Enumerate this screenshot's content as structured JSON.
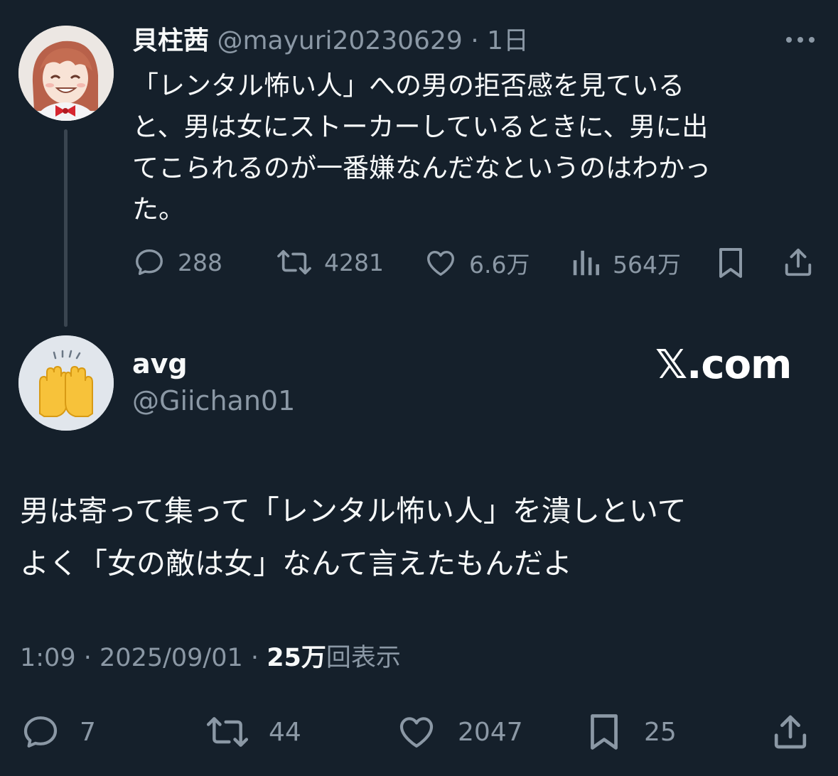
{
  "parent_tweet": {
    "display_name": "貝柱茜",
    "handle": "@mayuri20230629",
    "separator": "·",
    "time": "1日",
    "more_icon": "more-dots-icon",
    "text_lines": [
      "「レンタル怖い人」への男の拒否感を見ている",
      "と、男は女にストーカーしているときに、男に出",
      "てこられるのが一番嫌なんだなというのはわかっ",
      "た。"
    ],
    "actions": {
      "replies": "288",
      "retweets": "4281",
      "likes": "6.6万",
      "views": "564万"
    }
  },
  "reply_tweet": {
    "display_name": "avg",
    "handle": "@Giichan01",
    "watermark": "𝕏.com",
    "text_lines": [
      "男は寄って集って「レンタル怖い人」を潰しといて",
      "よく「女の敵は女」なんて言えたもんだよ"
    ],
    "meta": {
      "time": "1:09",
      "sep1": "·",
      "date": "2025/09/01",
      "sep2": "·",
      "views_count": "25万",
      "views_label": "回表示"
    },
    "actions": {
      "replies": "7",
      "retweets": "44",
      "likes": "2047",
      "bookmarks": "25"
    }
  },
  "colors": {
    "background": "#15202b",
    "text": "#f7f9f9",
    "muted": "#8b98a5",
    "thread_line": "#3a4550"
  }
}
